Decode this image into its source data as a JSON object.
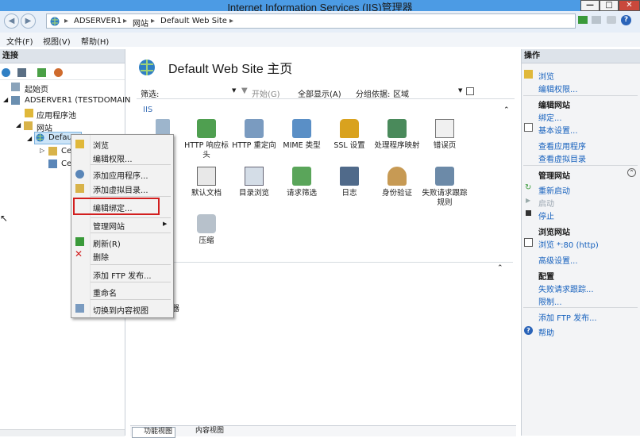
{
  "window": {
    "title": "Internet Information Services (IIS)管理器",
    "btn_min": "—",
    "btn_max": "□",
    "btn_close": "✕"
  },
  "address": {
    "crumbs": [
      "ADSERVER1",
      "网站",
      "Default Web Site"
    ],
    "sep": "▸"
  },
  "menu": {
    "file": "文件(F)",
    "view": "视图(V)",
    "help": "帮助(H)"
  },
  "left": {
    "header": "连接",
    "tree": {
      "start": "起始页",
      "server": "ADSERVER1 (TESTDOMAIN",
      "apppools": "应用程序池",
      "sites": "网站",
      "default_site": "Defau",
      "child1": "Ce",
      "child2": "Ce"
    }
  },
  "main": {
    "title": "Default Web Site 主页",
    "filter_label": "筛选:",
    "start_label": "开始(G)",
    "show_all_label": "全部显示(A)",
    "group_label": "分组依据:",
    "group_value": "区域",
    "section_iis": "IIS",
    "features_row1": [
      "HTTP 响应标头",
      "HTTP 重定向",
      "MIME 类型",
      "SSL 设置",
      "处理程序映射",
      "错误页"
    ],
    "features_row2": [
      "默认文档",
      "目录浏览",
      "请求筛选",
      "日志",
      "身份验证",
      "失败请求跟踪规则"
    ],
    "feature_compress": "压缩",
    "partial_text": "器",
    "tab_features": "功能视图",
    "tab_content": "内容视图"
  },
  "context_menu": {
    "browse": "浏览",
    "edit_permissions": "编辑权限...",
    "add_app": "添加应用程序...",
    "add_vdir": "添加虚拟目录...",
    "edit_bindings": "编辑绑定...",
    "manage_site": "管理网站",
    "refresh": "刷新(R)",
    "delete": "删除",
    "add_ftp": "添加 FTP 发布...",
    "rename": "重命名",
    "switch_content": "切换到内容视图"
  },
  "actions": {
    "header": "操作",
    "explore": "浏览",
    "edit_permissions": "编辑权限...",
    "edit_site_header": "编辑网站",
    "bindings": "绑定...",
    "basic_settings": "基本设置...",
    "view_apps": "查看应用程序",
    "view_vdirs": "查看虚拟目录",
    "manage_site_header": "管理网站",
    "restart": "重新启动",
    "start": "启动",
    "stop": "停止",
    "browse_header": "浏览网站",
    "browse_80": "浏览 *:80 (http)",
    "advanced": "高级设置...",
    "config_header": "配置",
    "failed_trace": "失败请求跟踪...",
    "limits": "限制...",
    "add_ftp": "添加 FTP 发布...",
    "help": "帮助"
  },
  "colors": {
    "accent": "#1560bd",
    "highlight_box": "#d21f1f",
    "titlebar": "#4c9be4"
  }
}
